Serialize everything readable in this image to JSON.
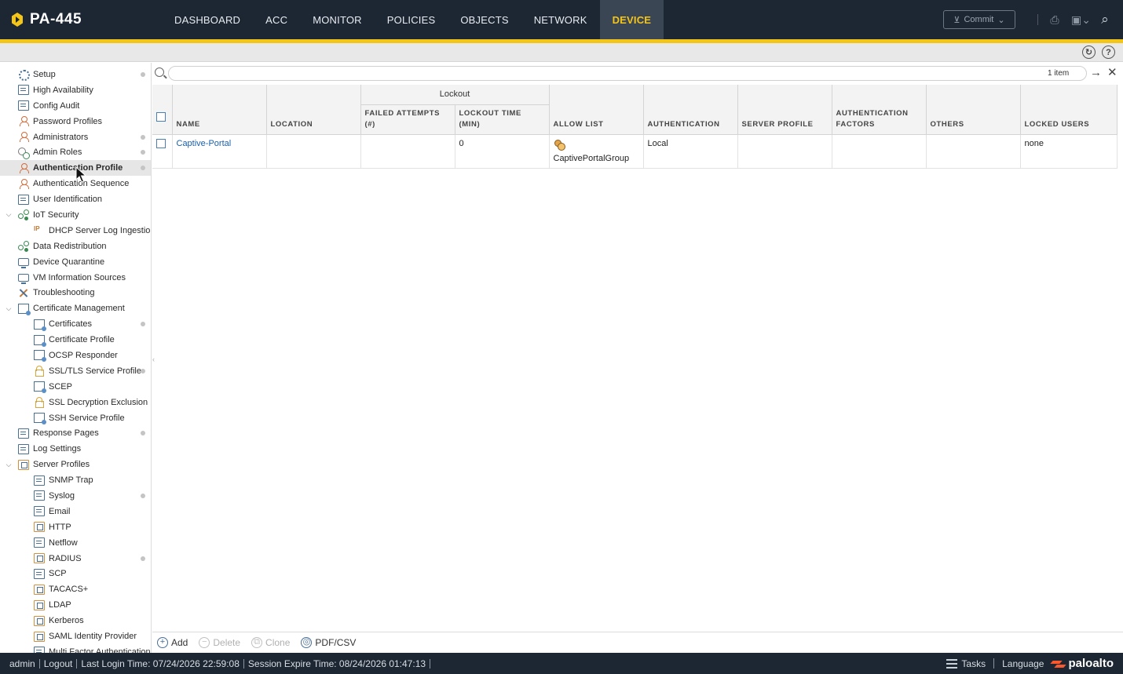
{
  "app": {
    "name": "PA-445"
  },
  "nav": [
    "DASHBOARD",
    "ACC",
    "MONITOR",
    "POLICIES",
    "OBJECTS",
    "NETWORK",
    "DEVICE"
  ],
  "nav_active": "DEVICE",
  "toolbar": {
    "commit_label": "Commit"
  },
  "sidebar": {
    "items": [
      {
        "label": "Setup",
        "icon": "gear-icon",
        "indent": 1,
        "dot": true
      },
      {
        "label": "High Availability",
        "icon": "server-icon",
        "indent": 1
      },
      {
        "label": "Config Audit",
        "icon": "document-icon",
        "indent": 1
      },
      {
        "label": "Password Profiles",
        "icon": "key-icon",
        "indent": 1
      },
      {
        "label": "Administrators",
        "icon": "person-icon",
        "indent": 1,
        "dot": true
      },
      {
        "label": "Admin Roles",
        "icon": "role-icon",
        "indent": 1,
        "dot": true
      },
      {
        "label": "Authentication Profile",
        "icon": "auth-profile-icon",
        "indent": 1,
        "dot": true,
        "selected": true
      },
      {
        "label": "Authentication Sequence",
        "icon": "auth-sequence-icon",
        "indent": 1
      },
      {
        "label": "User Identification",
        "icon": "user-id-icon",
        "indent": 1
      },
      {
        "label": "IoT Security",
        "icon": "network-icon",
        "indent": 1,
        "expanded": true
      },
      {
        "label": "DHCP Server Log Ingestion",
        "icon": "ip-icon",
        "indent": 2
      },
      {
        "label": "Data Redistribution",
        "icon": "network-icon",
        "indent": 1
      },
      {
        "label": "Device Quarantine",
        "icon": "monitor-icon",
        "indent": 1
      },
      {
        "label": "VM Information Sources",
        "icon": "monitor-icon",
        "indent": 1
      },
      {
        "label": "Troubleshooting",
        "icon": "tools-icon",
        "indent": 1
      },
      {
        "label": "Certificate Management",
        "icon": "certificate-icon",
        "indent": 1,
        "expanded": true
      },
      {
        "label": "Certificates",
        "icon": "certificate-icon",
        "indent": 2,
        "dot": true
      },
      {
        "label": "Certificate Profile",
        "icon": "certificate-icon",
        "indent": 2
      },
      {
        "label": "OCSP Responder",
        "icon": "certificate-icon",
        "indent": 2
      },
      {
        "label": "SSL/TLS Service Profile",
        "icon": "lock-icon",
        "indent": 2,
        "dot": true
      },
      {
        "label": "SCEP",
        "icon": "certificate-icon",
        "indent": 2
      },
      {
        "label": "SSL Decryption Exclusion",
        "icon": "lock-icon",
        "indent": 2
      },
      {
        "label": "SSH Service Profile",
        "icon": "certificate-icon",
        "indent": 2
      },
      {
        "label": "Response Pages",
        "icon": "document-icon",
        "indent": 1,
        "dot": true
      },
      {
        "label": "Log Settings",
        "icon": "document-icon",
        "indent": 1
      },
      {
        "label": "Server Profiles",
        "icon": "server-profile-icon",
        "indent": 1,
        "expanded": true
      },
      {
        "label": "SNMP Trap",
        "icon": "document-icon",
        "indent": 2
      },
      {
        "label": "Syslog",
        "icon": "document-icon",
        "indent": 2,
        "dot": true
      },
      {
        "label": "Email",
        "icon": "document-icon",
        "indent": 2
      },
      {
        "label": "HTTP",
        "icon": "http-icon",
        "indent": 2
      },
      {
        "label": "Netflow",
        "icon": "document-icon",
        "indent": 2
      },
      {
        "label": "RADIUS",
        "icon": "server-profile-icon",
        "indent": 2,
        "dot": true
      },
      {
        "label": "SCP",
        "icon": "document-icon",
        "indent": 2
      },
      {
        "label": "TACACS+",
        "icon": "server-profile-icon",
        "indent": 2
      },
      {
        "label": "LDAP",
        "icon": "server-profile-icon",
        "indent": 2
      },
      {
        "label": "Kerberos",
        "icon": "server-profile-icon",
        "indent": 2
      },
      {
        "label": "SAML Identity Provider",
        "icon": "server-profile-icon",
        "indent": 2
      },
      {
        "label": "Multi Factor Authentication",
        "icon": "document-icon",
        "indent": 2
      }
    ]
  },
  "search": {
    "value": "",
    "count": "1 item"
  },
  "table": {
    "group_header": "Lockout",
    "columns": [
      "NAME",
      "LOCATION",
      "FAILED ATTEMPTS (#)",
      "LOCKOUT TIME (MIN)",
      "ALLOW LIST",
      "AUTHENTICATION",
      "SERVER PROFILE",
      "AUTHENTICATION FACTORS",
      "OTHERS",
      "LOCKED USERS"
    ],
    "rows": [
      {
        "name": "Captive-Portal",
        "location": "",
        "failed_attempts": "",
        "lockout_time": "0",
        "allow_list": "CaptivePortalGroup",
        "authentication": "Local",
        "server_profile": "",
        "authentication_factors": "",
        "others": "",
        "locked_users": "none"
      }
    ]
  },
  "actions": {
    "add": "Add",
    "delete": "Delete",
    "clone": "Clone",
    "pdf_csv": "PDF/CSV"
  },
  "status": {
    "user": "admin",
    "logout": "Logout",
    "last_login": "Last Login Time: 07/24/2026 22:59:08",
    "session_expire": "Session Expire Time: 08/24/2026 01:47:13",
    "tasks": "Tasks",
    "language": "Language",
    "brand": "paloalto"
  },
  "colors": {
    "accent": "#f4c519",
    "topbar": "#1d2733",
    "link": "#1a5fa8",
    "brand": "#fa582d"
  }
}
